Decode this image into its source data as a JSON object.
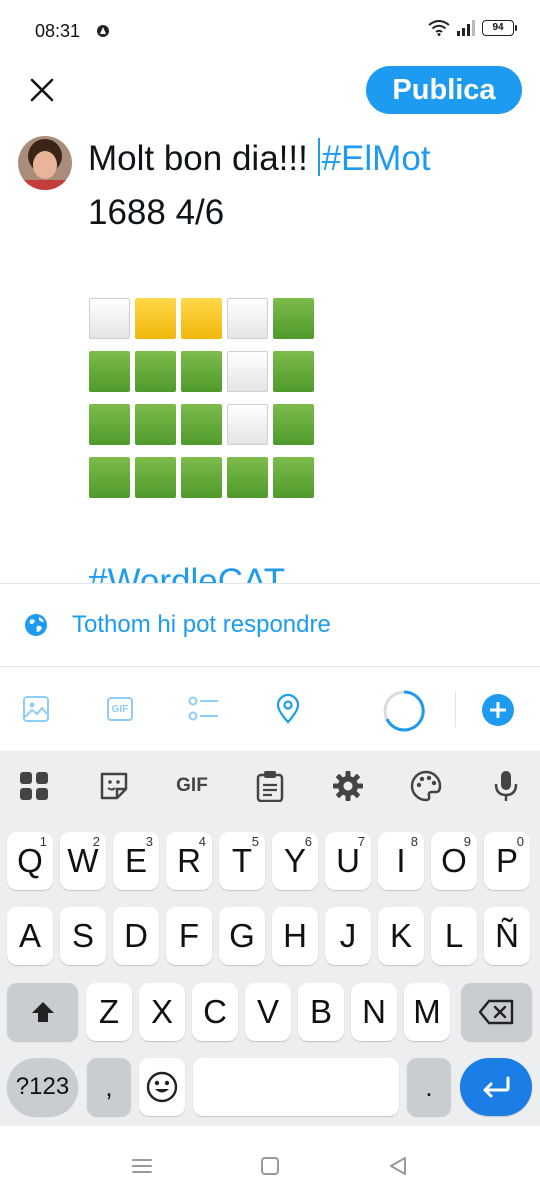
{
  "status_bar": {
    "time": "08:31",
    "battery": "94"
  },
  "header": {
    "publish_label": "Publica"
  },
  "composer": {
    "line1_text": "Molt bon dia!!! ",
    "line1_hashtag": "#ElMot",
    "line2_text": "1688 4/6",
    "hashtag2": "#WordleCAT",
    "grid": [
      [
        "white",
        "yellow",
        "yellow",
        "white",
        "green"
      ],
      [
        "green",
        "green",
        "green",
        "white",
        "green"
      ],
      [
        "green",
        "green",
        "green",
        "white",
        "green"
      ],
      [
        "green",
        "green",
        "green",
        "green",
        "green"
      ]
    ]
  },
  "reply_setting": {
    "label": "Tothom hi pot respondre"
  },
  "toolbar": {
    "icons": [
      "image-icon",
      "gif-icon",
      "poll-icon",
      "location-icon",
      "progress-ring-icon",
      "add-icon"
    ],
    "gif_label": "GIF"
  },
  "keyboard": {
    "toolbar": {
      "gif_label": "GIF"
    },
    "row1": [
      "Q",
      "W",
      "E",
      "R",
      "T",
      "Y",
      "U",
      "I",
      "O",
      "P"
    ],
    "row1_hints": [
      "1",
      "2",
      "3",
      "4",
      "5",
      "6",
      "7",
      "8",
      "9",
      "0"
    ],
    "row2": [
      "A",
      "S",
      "D",
      "F",
      "G",
      "H",
      "J",
      "K",
      "L",
      "Ñ"
    ],
    "row3": [
      "Z",
      "X",
      "C",
      "V",
      "B",
      "N",
      "M"
    ],
    "symbols_label": "?123",
    "comma": ",",
    "period": "."
  },
  "colors": {
    "accent": "#1d9bf0",
    "tile_green": "#5fa83a",
    "tile_yellow": "#f6c52a",
    "tile_white": "#f2f2f2",
    "keyboard_bg": "#eceef0"
  }
}
